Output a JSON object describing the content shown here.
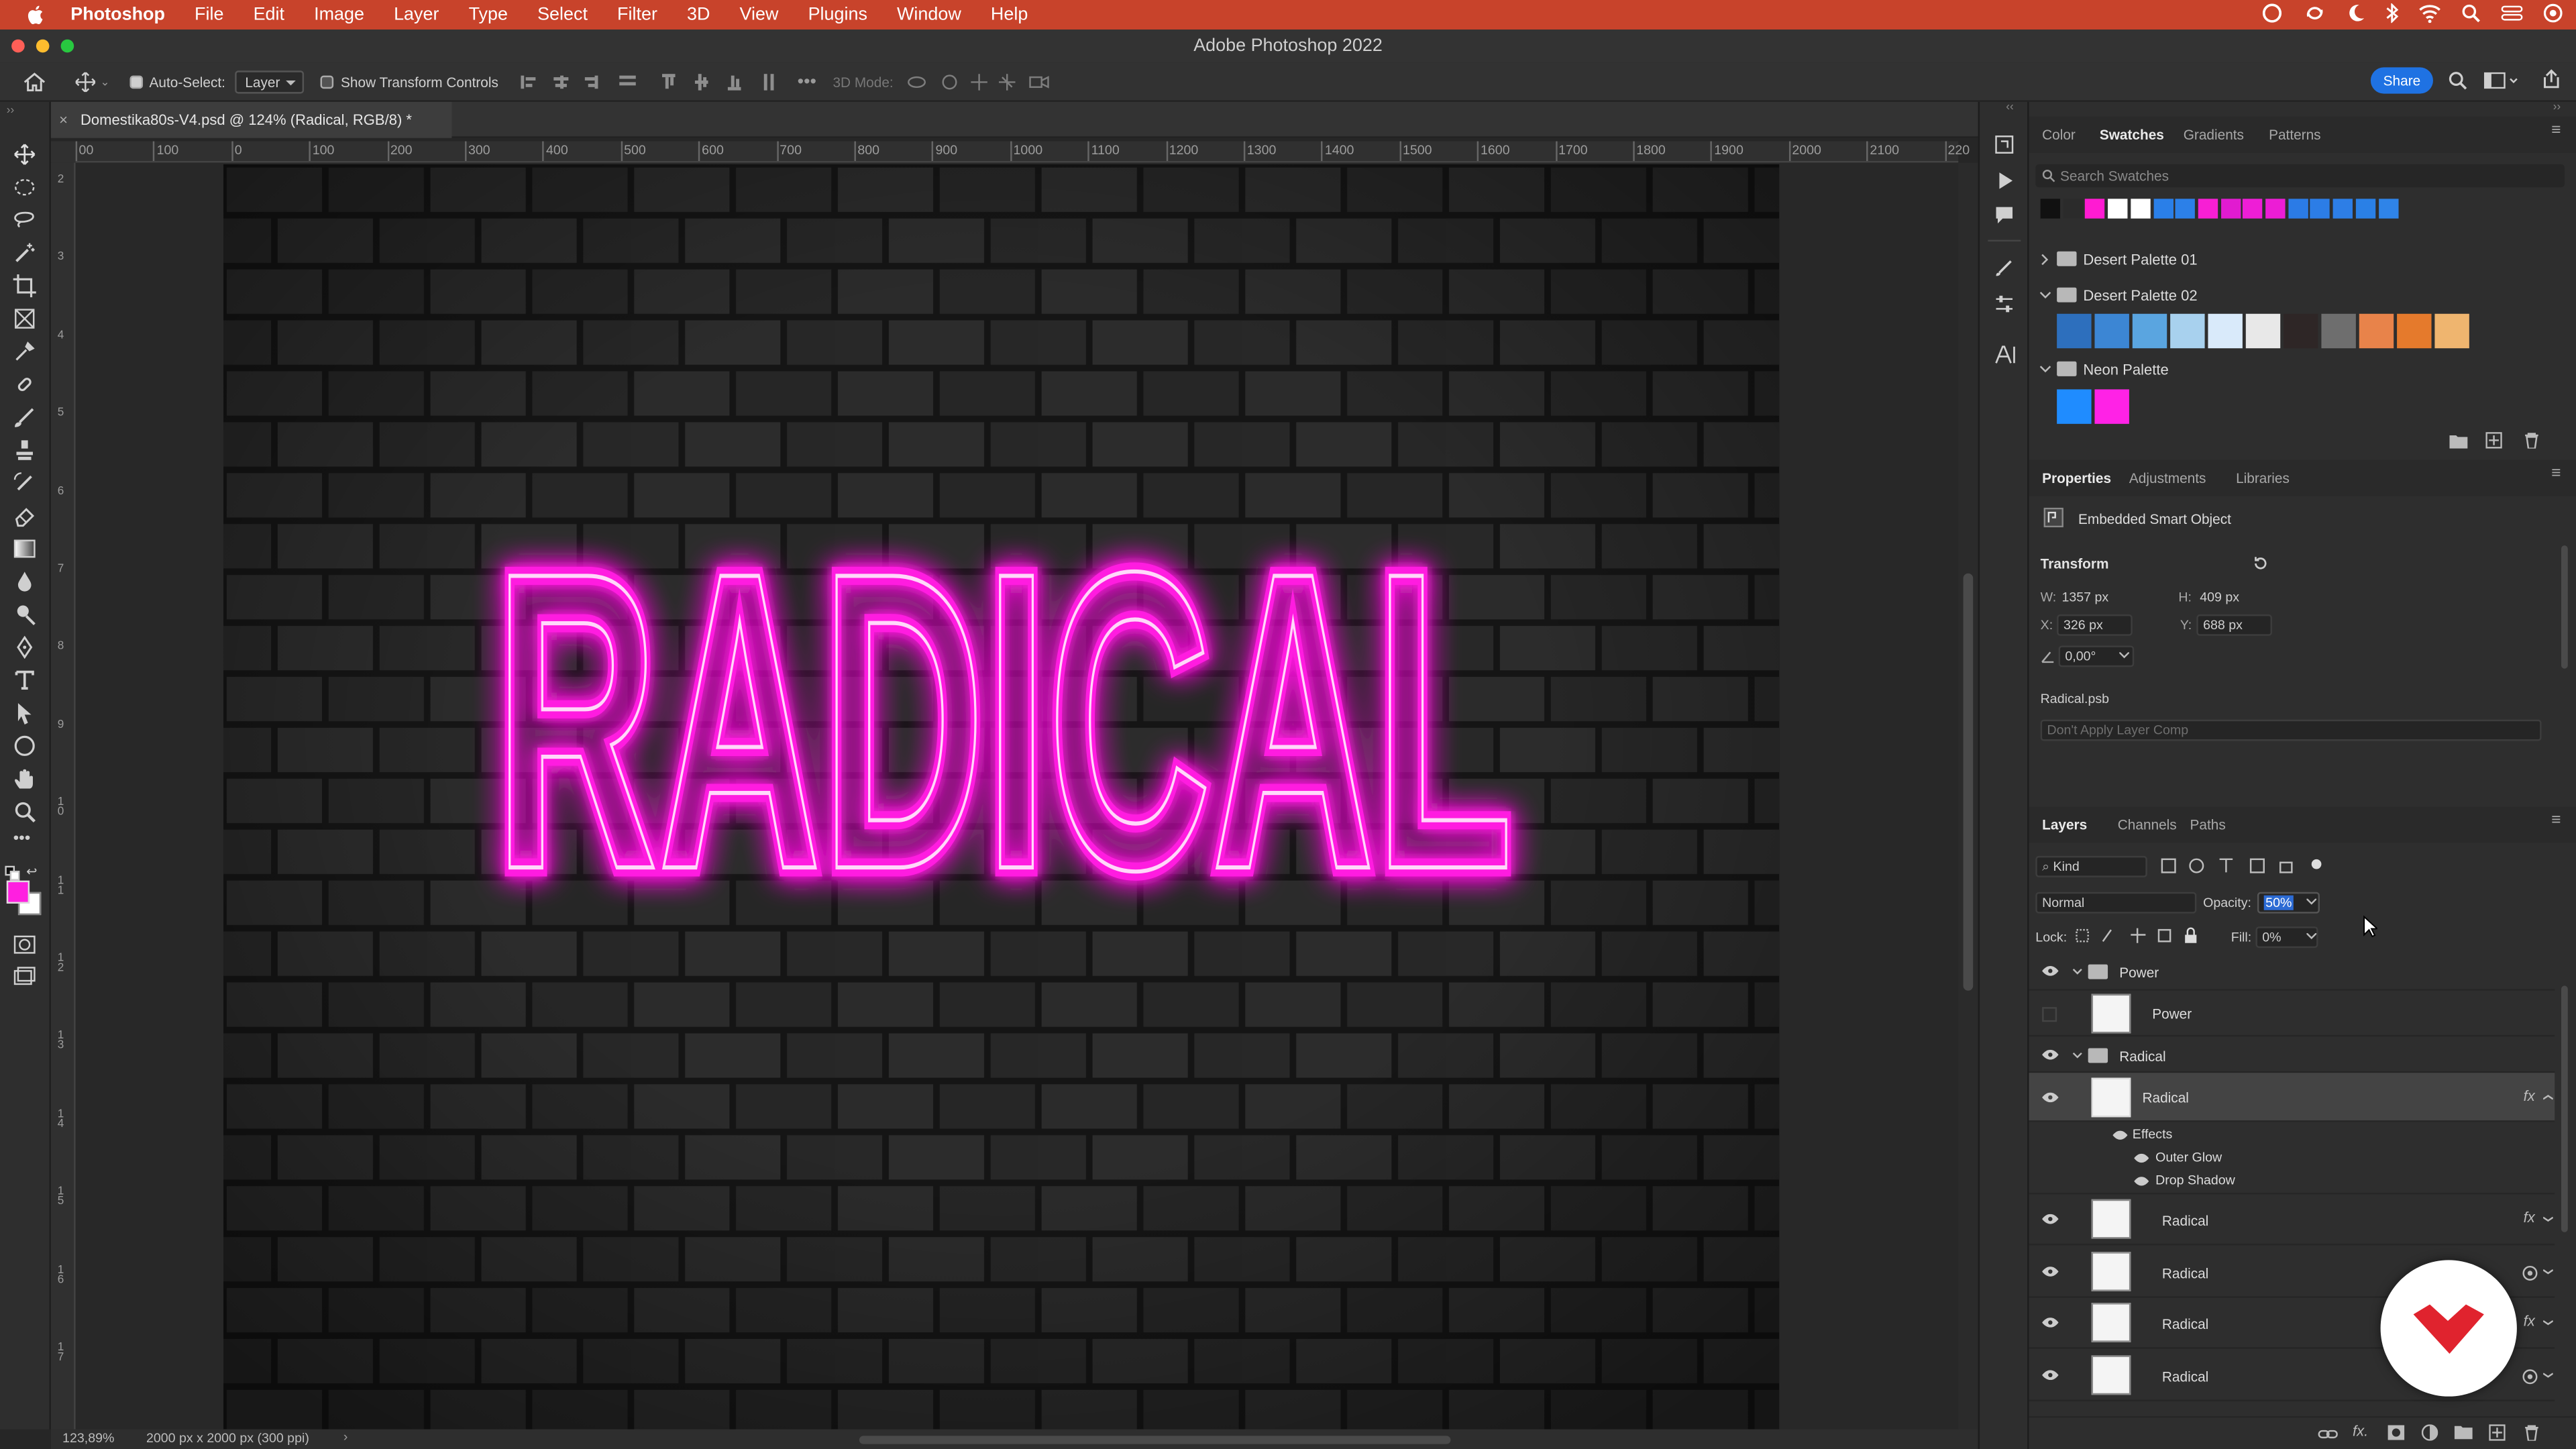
{
  "menubar": {
    "app": "Photoshop",
    "items": [
      "File",
      "Edit",
      "Image",
      "Layer",
      "Type",
      "Select",
      "Filter",
      "3D",
      "View",
      "Plugins",
      "Window",
      "Help"
    ]
  },
  "window": {
    "title": "Adobe Photoshop 2022"
  },
  "options": {
    "auto_select_label": "Auto-Select:",
    "auto_select_value": "Layer",
    "transform_label": "Show Transform Controls",
    "mode3d_label": "3D Mode:",
    "share": "Share"
  },
  "document": {
    "tab": "Domestika80s-V4.psd @ 124% (Radical, RGB/8) *",
    "canvas_text": "RADICAL",
    "zoom": "123,89%",
    "doc_info": "2000 px x 2000 px (300 ppi)"
  },
  "rulers": {
    "top": [
      "00",
      "100",
      "0",
      "100",
      "200",
      "300",
      "400",
      "500",
      "600",
      "700",
      "800",
      "900",
      "1000",
      "1100",
      "1200",
      "1300",
      "1400",
      "1500",
      "1600",
      "1700",
      "1800",
      "1900",
      "2000",
      "2100",
      "220"
    ],
    "left": [
      "2",
      "3",
      "4",
      "5",
      "6",
      "7",
      "8",
      "9",
      "1 0",
      "1 1",
      "1 2",
      "1 3",
      "1 4",
      "1 5",
      "1 6",
      "1 7"
    ]
  },
  "swatches_panel": {
    "tabs": [
      "Color",
      "Swatches",
      "Gradients",
      "Patterns"
    ],
    "search_placeholder": "Search Swatches",
    "recent": [
      "#111111",
      "#2b2b2b",
      "#ff1bd2",
      "#ffffff",
      "#ffffff",
      "#2a7fe8",
      "#2c80e8",
      "#f71fd4",
      "#e11bd0",
      "#ee1ed6",
      "#ec1dd5",
      "#2b7be6",
      "#2c7de6",
      "#2d7ee6",
      "#2a80e6",
      "#2f84e8"
    ],
    "groups": [
      {
        "name": "Desert Palette 01",
        "expanded": false,
        "colors": []
      },
      {
        "name": "Desert Palette 02",
        "expanded": true,
        "colors": [
          "#2d6fbd",
          "#3c86d4",
          "#5aa5e0",
          "#a8d1ee",
          "#d9eafa",
          "#e8e8e8",
          "#2e2626",
          "#6e6e6e",
          "#e8834a",
          "#e57a2c",
          "#efb56f"
        ]
      },
      {
        "name": "Neon Palette",
        "expanded": true,
        "colors": [
          "#1f8cff",
          "#ff22e6"
        ]
      }
    ]
  },
  "properties_panel": {
    "tabs": [
      "Properties",
      "Adjustments",
      "Libraries"
    ],
    "type_label": "Embedded Smart Object",
    "transform_label": "Transform",
    "w_label": "W:",
    "w": "1357 px",
    "h_label": "H:",
    "h": "409 px",
    "x_label": "X:",
    "x": "326 px",
    "y_label": "Y:",
    "y": "688 px",
    "angle": "0,00°",
    "file": "Radical.psb",
    "layer_comp": "Don't Apply Layer Comp"
  },
  "layers_panel": {
    "tabs": [
      "Layers",
      "Channels",
      "Paths"
    ],
    "filter": "Kind",
    "blend": "Normal",
    "opacity_label": "Opacity:",
    "opacity": "50%",
    "lock_label": "Lock:",
    "fill_label": "Fill:",
    "fill": "0%",
    "group1": "Power",
    "layer_power": "Power",
    "group2": "Radical",
    "selected_layer": "Radical",
    "effects": "Effects",
    "outer_glow": "Outer Glow",
    "drop_shadow": "Drop Shadow",
    "more_layers": [
      "Radical",
      "Radical",
      "Radical",
      "Radical"
    ],
    "fx": "fx"
  },
  "colors": {
    "neon": "#ff1fe0",
    "accent": "#1f72e3",
    "menubar": "#c8432b",
    "brand": "#e0232e"
  }
}
